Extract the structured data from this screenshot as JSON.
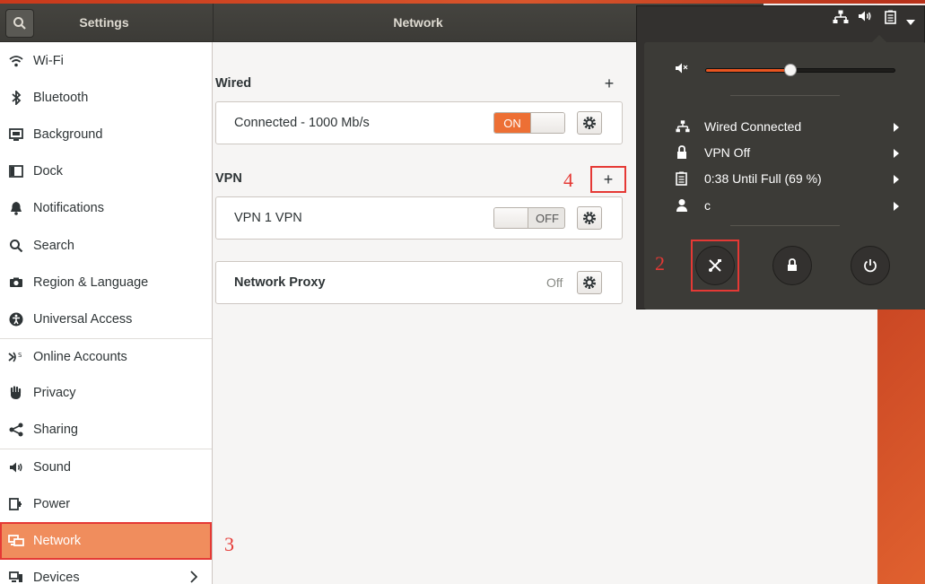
{
  "header": {
    "settings_title": "Settings",
    "main_title": "Network"
  },
  "sidebar": {
    "items": [
      {
        "label": "Wi-Fi",
        "icon": "wifi-icon"
      },
      {
        "label": "Bluetooth",
        "icon": "bluetooth-icon"
      },
      {
        "label": "Background",
        "icon": "background-icon"
      },
      {
        "label": "Dock",
        "icon": "dock-icon"
      },
      {
        "label": "Notifications",
        "icon": "bell-icon"
      },
      {
        "label": "Search",
        "icon": "search-icon"
      },
      {
        "label": "Region & Language",
        "icon": "camera-icon"
      },
      {
        "label": "Universal Access",
        "icon": "accessibility-icon"
      },
      {
        "label": "Online Accounts",
        "icon": "online-accounts-icon"
      },
      {
        "label": "Privacy",
        "icon": "hand-icon"
      },
      {
        "label": "Sharing",
        "icon": "share-icon"
      },
      {
        "label": "Sound",
        "icon": "speaker-icon"
      },
      {
        "label": "Power",
        "icon": "power-plug-icon"
      },
      {
        "label": "Network",
        "icon": "network-icon"
      },
      {
        "label": "Devices",
        "icon": "devices-icon"
      }
    ],
    "selected": "Network"
  },
  "network": {
    "wired_title": "Wired",
    "wired_status": "Connected - 1000 Mb/s",
    "wired_toggle": "ON",
    "vpn_title": "VPN",
    "vpn_name": "VPN 1 VPN",
    "vpn_toggle": "OFF",
    "proxy_label": "Network Proxy",
    "proxy_status": "Off"
  },
  "system_menu": {
    "volume_percent": 45,
    "items": [
      {
        "label": "Wired Connected",
        "icon": "network-icon"
      },
      {
        "label": "VPN Off",
        "icon": "vpn-lock-icon"
      },
      {
        "label": "0:38 Until Full (69 %)",
        "icon": "battery-icon"
      },
      {
        "label": "c",
        "icon": "user-icon"
      }
    ],
    "buttons": [
      "settings-tools-icon",
      "lock-icon",
      "power-icon"
    ]
  },
  "annotations": {
    "step2": "2",
    "step3": "3",
    "step4": "4"
  },
  "colors": {
    "accent": "#ed6f34",
    "highlight": "#e53935",
    "sidebar_active": "#f08d5d",
    "menu_bg": "#3c3b37"
  }
}
